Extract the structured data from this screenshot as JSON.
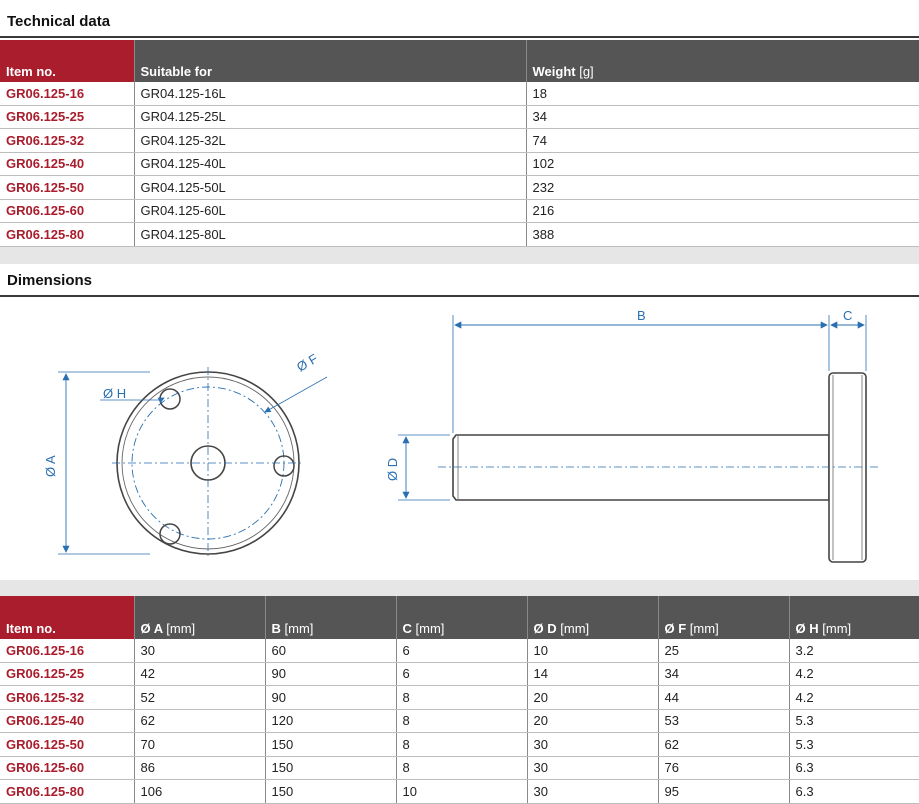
{
  "technical_data": {
    "title": "Technical data",
    "headers": {
      "item_no": "Item no.",
      "suitable_for": "Suitable for",
      "weight": "Weight",
      "weight_unit": "[g]"
    },
    "rows": [
      {
        "item_no": "GR06.125-16",
        "suitable_for": "GR04.125-16L",
        "weight": "18"
      },
      {
        "item_no": "GR06.125-25",
        "suitable_for": "GR04.125-25L",
        "weight": "34"
      },
      {
        "item_no": "GR06.125-32",
        "suitable_for": "GR04.125-32L",
        "weight": "74"
      },
      {
        "item_no": "GR06.125-40",
        "suitable_for": "GR04.125-40L",
        "weight": "102"
      },
      {
        "item_no": "GR06.125-50",
        "suitable_for": "GR04.125-50L",
        "weight": "232"
      },
      {
        "item_no": "GR06.125-60",
        "suitable_for": "GR04.125-60L",
        "weight": "216"
      },
      {
        "item_no": "GR06.125-80",
        "suitable_for": "GR04.125-80L",
        "weight": "388"
      }
    ]
  },
  "dimensions": {
    "title": "Dimensions",
    "drawing_labels": {
      "a": "Ø A",
      "b": "B",
      "c": "C",
      "d": "Ø D",
      "f": "Ø F",
      "h": "Ø H"
    },
    "headers": {
      "item_no": "Item no.",
      "a": "Ø A",
      "a_unit": "[mm]",
      "b": "B",
      "b_unit": "[mm]",
      "c": "C",
      "c_unit": "[mm]",
      "d": "Ø D",
      "d_unit": "[mm]",
      "f": "Ø F",
      "f_unit": "[mm]",
      "h": "Ø H",
      "h_unit": "[mm]"
    },
    "rows": [
      {
        "item_no": "GR06.125-16",
        "a": "30",
        "b": "60",
        "c": "6",
        "d": "10",
        "f": "25",
        "h": "3.2"
      },
      {
        "item_no": "GR06.125-25",
        "a": "42",
        "b": "90",
        "c": "6",
        "d": "14",
        "f": "34",
        "h": "4.2"
      },
      {
        "item_no": "GR06.125-32",
        "a": "52",
        "b": "90",
        "c": "8",
        "d": "20",
        "f": "44",
        "h": "4.2"
      },
      {
        "item_no": "GR06.125-40",
        "a": "62",
        "b": "120",
        "c": "8",
        "d": "20",
        "f": "53",
        "h": "5.3"
      },
      {
        "item_no": "GR06.125-50",
        "a": "70",
        "b": "150",
        "c": "8",
        "d": "30",
        "f": "62",
        "h": "5.3"
      },
      {
        "item_no": "GR06.125-60",
        "a": "86",
        "b": "150",
        "c": "8",
        "d": "30",
        "f": "76",
        "h": "6.3"
      },
      {
        "item_no": "GR06.125-80",
        "a": "106",
        "b": "150",
        "c": "10",
        "d": "30",
        "f": "95",
        "h": "6.3"
      }
    ]
  },
  "colors": {
    "accent": "#a91d2c",
    "header_gray": "#555555",
    "dim_blue": "#2a6fb0"
  }
}
